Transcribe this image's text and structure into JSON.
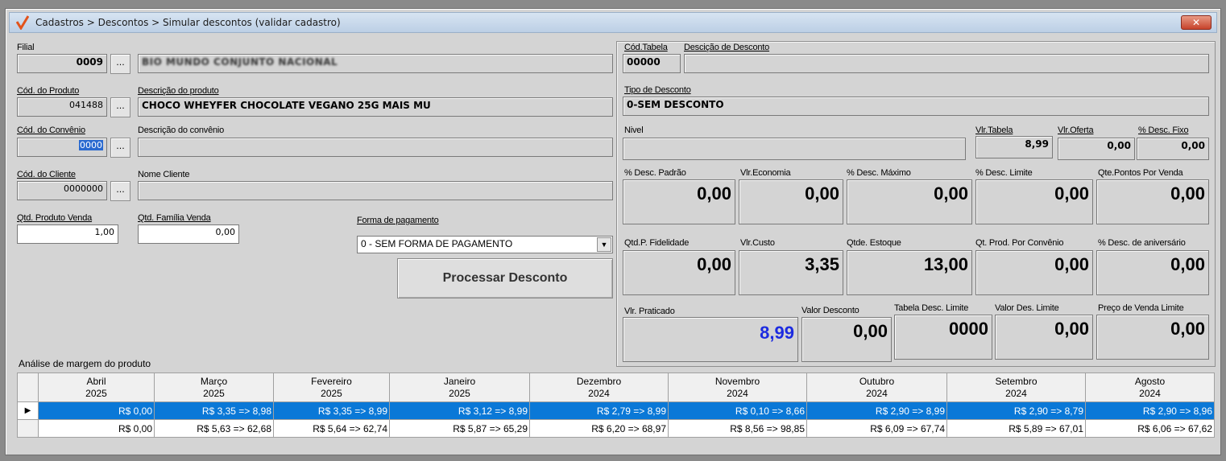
{
  "title": "Cadastros > Descontos > Simular descontos (validar cadastro)",
  "close_label": "✕",
  "left": {
    "filial": {
      "label": "Filial",
      "code": "0009",
      "name": "BIO MUNDO CONJUNTO NACIONAL"
    },
    "produto": {
      "code_label": "Cód. do Produto",
      "code": "041488",
      "desc_label": "Descrição  do produto",
      "desc": "CHOCO WHEYFER CHOCOLATE VEGANO 25G MAIS MU"
    },
    "convenio": {
      "code_label": "Cód. do Convênio",
      "code": "0000",
      "desc_label": "Descrição  do convênio",
      "desc": ""
    },
    "cliente": {
      "code_label": "Cód. do Cliente",
      "code": "0000000",
      "desc_label": "Nome Cliente",
      "desc": ""
    },
    "qtd_produto": {
      "label": "Qtd. Produto Venda",
      "value": "1,00"
    },
    "qtd_familia": {
      "label": "Qtd. Família Venda",
      "value": "0,00"
    },
    "forma_pagamento": {
      "label": "Forma de pagamento",
      "value": "0 - SEM FORMA DE PAGAMENTO"
    },
    "dots": "...",
    "process_button": "Processar Desconto"
  },
  "right": {
    "cod_tabela": {
      "label": "Cód.Tabela",
      "value": "00000"
    },
    "desc_desconto": {
      "label": "Descição de Desconto",
      "value": ""
    },
    "tipo_desconto": {
      "label": "Tipo de Desconto",
      "value": "0-SEM DESCONTO"
    },
    "nivel": {
      "label": "Nivel",
      "value": ""
    },
    "vlr_tabela": {
      "label": "Vlr.Tabela",
      "value": "8,99"
    },
    "vlr_oferta": {
      "label": "Vlr.Oferta",
      "value": "0,00"
    },
    "desc_fixo": {
      "label": "% Desc. Fixo",
      "value": "0,00"
    },
    "row1": [
      {
        "label": "% Desc. Padrão",
        "value": "0,00"
      },
      {
        "label": "Vlr.Economia",
        "value": "0,00"
      },
      {
        "label": "% Desc. Máximo",
        "value": "0,00"
      },
      {
        "label": "% Desc. Limite",
        "value": "0,00"
      },
      {
        "label": "Qte.Pontos Por Venda",
        "value": "0,00"
      }
    ],
    "row2": [
      {
        "label": "Qtd.P. Fidelidade",
        "value": "0,00"
      },
      {
        "label": "Vlr.Custo",
        "value": "3,35"
      },
      {
        "label": "Qtde. Estoque",
        "value": "13,00"
      },
      {
        "label": "Qt. Prod. Por Convênio",
        "value": "0,00"
      },
      {
        "label": "% Desc. de aniversário",
        "value": "0,00"
      }
    ],
    "row3": [
      {
        "label": "Vlr. Praticado",
        "value": "8,99"
      },
      {
        "label": "Valor Desconto",
        "value": "0,00"
      },
      {
        "label": "Tabela Desc. Limite",
        "value": "0000"
      },
      {
        "label": "Valor Des. Limite",
        "value": "0,00"
      },
      {
        "label": "Preço de Venda Limite",
        "value": "0,00"
      }
    ],
    "highlight_color": "#1c2be0"
  },
  "grid": {
    "title": "Análise de margem do produto",
    "columns": [
      {
        "month": "Abril",
        "year": "2025"
      },
      {
        "month": "Março",
        "year": "2025"
      },
      {
        "month": "Fevereiro",
        "year": "2025"
      },
      {
        "month": "Janeiro",
        "year": "2025"
      },
      {
        "month": "Dezembro",
        "year": "2024"
      },
      {
        "month": "Novembro",
        "year": "2024"
      },
      {
        "month": "Outubro",
        "year": "2024"
      },
      {
        "month": "Setembro",
        "year": "2024"
      },
      {
        "month": "Agosto",
        "year": "2024"
      }
    ],
    "rows": [
      {
        "indicator": "▶",
        "cells": [
          "R$ 0,00",
          "R$ 3,35 => 8,98",
          "R$ 3,35 => 8,99",
          "R$ 3,12 => 8,99",
          "R$ 2,79 => 8,99",
          "R$ 0,10 => 8,66",
          "R$ 2,90 => 8,99",
          "R$ 2,90 => 8,79",
          "R$ 2,90 => 8,96"
        ]
      },
      {
        "indicator": "",
        "cells": [
          "R$ 0,00",
          "R$ 5,63 => 62,68",
          "R$ 5,64 => 62,74",
          "R$ 5,87 => 65,29",
          "R$ 6,20 => 68,97",
          "R$ 8,56 => 98,85",
          "R$ 6,09 => 67,74",
          "R$ 5,89 => 67,01",
          "R$ 6,06 => 67,62"
        ]
      }
    ],
    "selected_color": "#0a78d7"
  }
}
